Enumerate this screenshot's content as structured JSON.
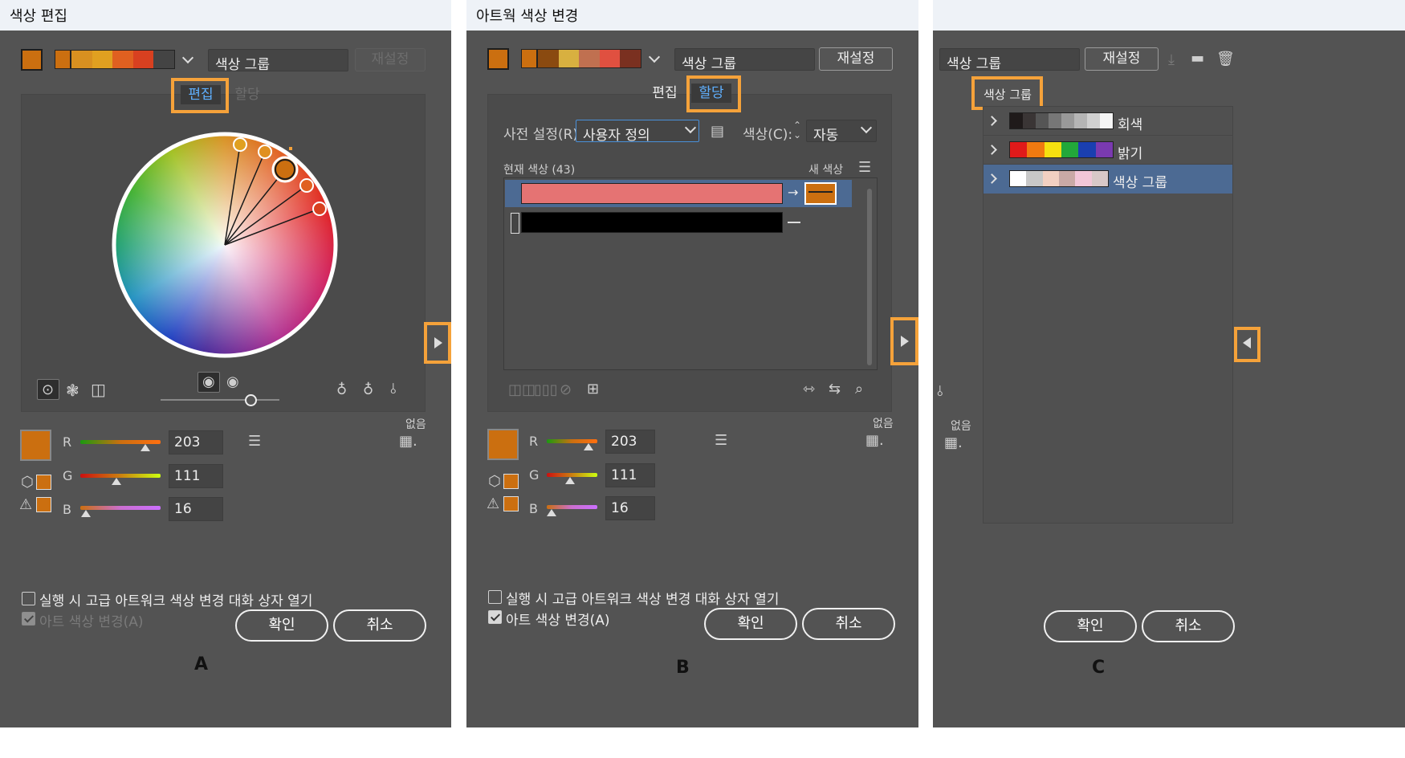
{
  "panelA": {
    "title": "색상 편집",
    "group_field": "색상 그룹",
    "reset": "재설정",
    "tab_edit": "편집",
    "tab_assign": "할당",
    "none_label": "없음",
    "r_label": "R",
    "g_label": "G",
    "b_label": "B",
    "r_value": "203",
    "g_value": "111",
    "b_value": "16",
    "checkbox1": "실행 시 고급 아트워크 색상 변경 대화 상자 열기",
    "checkbox2": "아트 색상 변경(A)",
    "ok": "확인",
    "cancel": "취소",
    "caption": "A"
  },
  "panelB": {
    "title": "아트웍 색상 변경",
    "group_field": "색상 그룹",
    "reset": "재설정",
    "tab_edit": "편집",
    "tab_assign": "할당",
    "preset_label": "사전 설정(R):",
    "preset_value": "사용자 정의",
    "colors_label": "색상(C):",
    "colors_value": "자동",
    "current_colors": "현재 색상 (43)",
    "new_color": "새 색상",
    "none_label": "없음",
    "r_label": "R",
    "g_label": "G",
    "b_label": "B",
    "r_value": "203",
    "g_value": "111",
    "b_value": "16",
    "checkbox1": "실행 시 고급 아트워크 색상 변경 대화 상자 열기",
    "checkbox2": "아트 색상 변경(A)",
    "ok": "확인",
    "cancel": "취소",
    "caption": "B"
  },
  "panelC": {
    "group_field": "색상 그룹",
    "reset": "재설정",
    "group_header": "색상 그룹",
    "groups": [
      {
        "name": "회색",
        "colors": [
          "#1f1a1a",
          "#3a3535",
          "#555",
          "#777",
          "#999",
          "#b5b5b5",
          "#d0d0d0",
          "#f5f5f5"
        ]
      },
      {
        "name": "밝기",
        "colors": [
          "#e01a1a",
          "#f07a10",
          "#f5e010",
          "#22a83a",
          "#1a3fb0",
          "#7a3ab0"
        ]
      },
      {
        "name": "색상 그룹",
        "colors": [
          "#ffffff",
          "#c8c8c8",
          "#f2d0c2",
          "#c9a9a6",
          "#f2c6d8",
          "#d8c8c8"
        ]
      }
    ],
    "none_label": "없음",
    "ok": "확인",
    "cancel": "취소",
    "caption": "C"
  },
  "colors": {
    "accent_orange": "#f5a23a",
    "current_color": "#cb6f10",
    "harmony": [
      "#cb6f10",
      "#d89020",
      "#e0a020",
      "#e06020",
      "#d84020"
    ]
  }
}
